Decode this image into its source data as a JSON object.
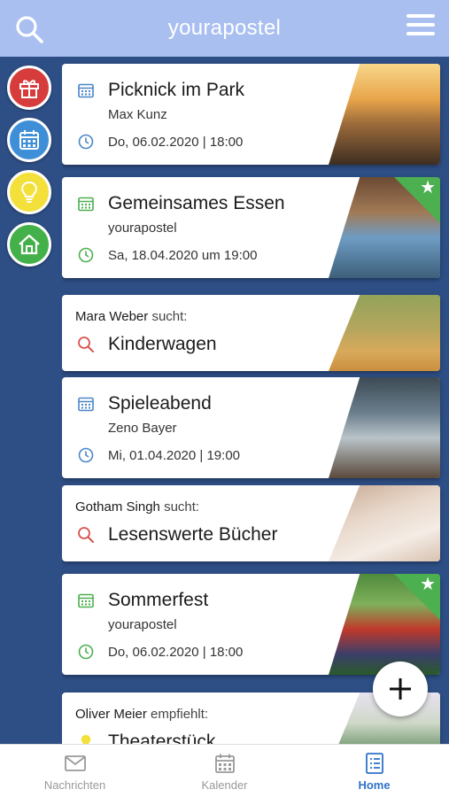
{
  "header": {
    "title": "yourapostel"
  },
  "cards": [
    {
      "type": "event",
      "title": "Picknick im Park",
      "subtitle": "Max Kunz",
      "date": "Do, 06.02.2020 | 18:00",
      "accent": "#4a86c8",
      "featured": false
    },
    {
      "type": "event",
      "title": "Gemeinsames Essen",
      "subtitle": "yourapostel",
      "date": "Sa, 18.04.2020 um 19:00",
      "accent": "#4caf50",
      "featured": true
    },
    {
      "type": "search",
      "who": "Mara Weber",
      "verb": "sucht:",
      "title": "Kinderwagen",
      "accent": "#d9534f"
    },
    {
      "type": "event",
      "title": "Spieleabend",
      "subtitle": "Zeno Bayer",
      "date": "Mi, 01.04.2020 | 19:00",
      "accent": "#4a86c8",
      "featured": false
    },
    {
      "type": "search",
      "who": "Gotham Singh",
      "verb": "sucht:",
      "title": "Lesenswerte Bücher",
      "accent": "#d9534f"
    },
    {
      "type": "event",
      "title": "Sommerfest",
      "subtitle": "yourapostel",
      "date": "Do, 06.02.2020 | 18:00",
      "accent": "#4caf50",
      "featured": true
    },
    {
      "type": "recommend",
      "who": "Oliver Meier",
      "verb": "empfiehlt:",
      "title": "Theaterstück",
      "accent": "#f3e03a"
    }
  ],
  "sidebar": {
    "items": [
      {
        "icon": "gift-icon",
        "color": "#d63c3c"
      },
      {
        "icon": "calendar-icon",
        "color": "#3f8fd8"
      },
      {
        "icon": "lightbulb-icon",
        "color": "#f3e03a"
      },
      {
        "icon": "home-icon",
        "color": "#44b04a"
      }
    ]
  },
  "bottom_nav": {
    "items": [
      {
        "label": "Nachrichten",
        "icon": "mail-icon",
        "active": false
      },
      {
        "label": "Kalender",
        "icon": "calendar-icon",
        "active": false
      },
      {
        "label": "Home",
        "icon": "list-icon",
        "active": true
      }
    ]
  },
  "colors": {
    "header": "#a9bff0",
    "background": "#2e4f86",
    "active_tab": "#2f73c9"
  }
}
